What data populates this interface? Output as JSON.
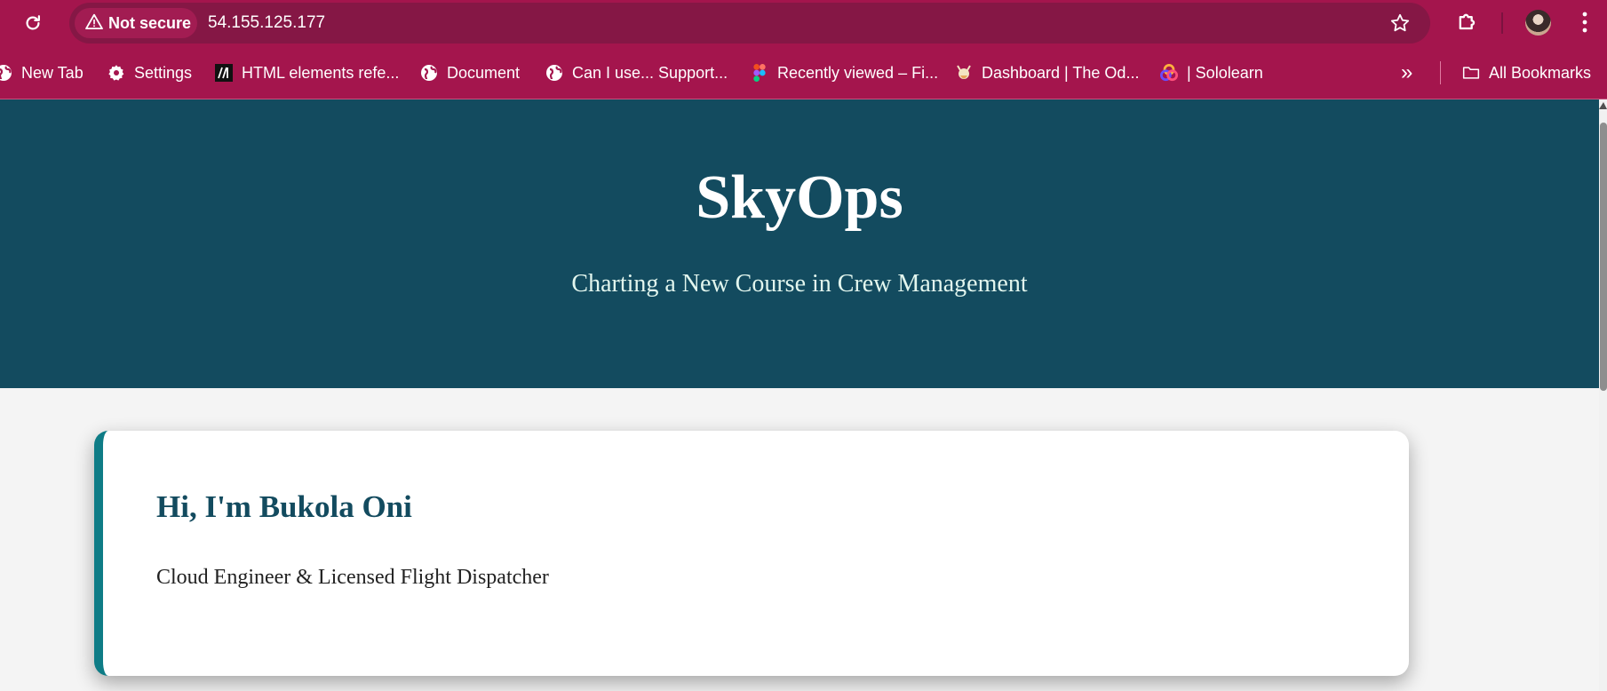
{
  "browser": {
    "security_label": "Not secure",
    "url": "54.155.125.177",
    "bookmarks": [
      {
        "label": "New Tab",
        "icon": "globe-icon"
      },
      {
        "label": "Settings",
        "icon": "gear-icon"
      },
      {
        "label": "HTML elements refe...",
        "icon": "mdn-icon"
      },
      {
        "label": "Document",
        "icon": "globe-icon"
      },
      {
        "label": "Can I use... Support...",
        "icon": "globe-icon"
      },
      {
        "label": "Recently viewed – Fi...",
        "icon": "figma-icon"
      },
      {
        "label": "Dashboard | The Od...",
        "icon": "odin-icon"
      },
      {
        "label": "| Sololearn",
        "icon": "sololearn-icon"
      }
    ],
    "overflow_label": "»",
    "all_bookmarks_label": "All Bookmarks",
    "colors": {
      "toolbar": "#a4154d",
      "omnibox": "#851745"
    }
  },
  "hero": {
    "title": "SkyOps",
    "subtitle": "Charting a New Course in Crew Management",
    "background": "#134b5f"
  },
  "intro_card": {
    "heading": "Hi, I'm Bukola Oni",
    "tagline": "Cloud Engineer & Licensed Flight Dispatcher",
    "accent": "#0e7c86"
  }
}
